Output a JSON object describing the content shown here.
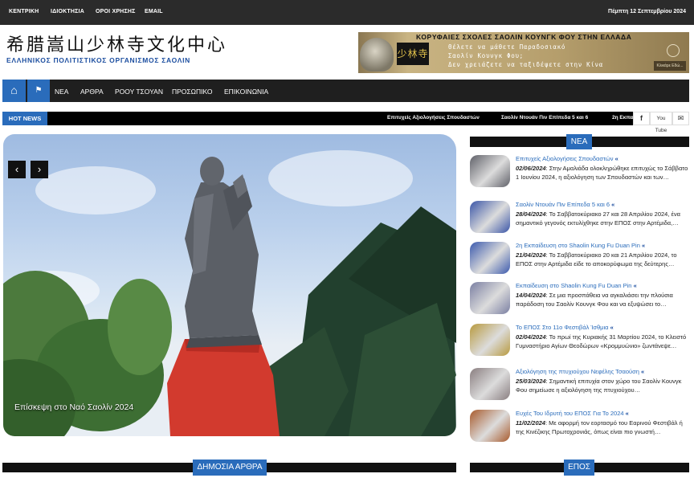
{
  "topbar": {
    "links": [
      "ΚΕΝΤΡΙΚΗ",
      "ΙΔΙΟΚΤΗΣΙΑ",
      "ΟΡΟΙ ΧΡΗΣΗΣ",
      "EMAIL"
    ],
    "date": "Πέμπτη 12 Σεπτεμβρίου 2024"
  },
  "logo": {
    "chinese": "希腊嵩山少林寺文化中心",
    "subtitle": "ΕΛΛΗΝΙΚΟΣ ΠΟΛΙΤΙΣΤΙΚΟΣ ΟΡΓΑΝΙΣΜΟΣ ΣΑΟΛΙΝ"
  },
  "banner": {
    "title": "ΚΟΡΥΦΑΙΕΣ ΣΧΟΛΕΣ ΣΑΟΛΙΝ ΚΟΥΝΓΚ ΦΟΥ ΣΤΗΝ ΕΛΛΑΔΑ",
    "line1": "Θέλετε να μάθετε Παραδοσιακό",
    "line2": "Σαολίν Κουνγκ Φου;",
    "line3": "Δεν χρειάζετε να ταξιδέψετε",
    "line4": "στην Κίνα",
    "seal": "少林寺",
    "button": "Κλικάρε Εδώ..."
  },
  "nav": {
    "items": [
      "ΝΕΑ",
      "ΑΡΘΡΑ",
      "ΡΟΟΥ ΤΣΟΥΑΝ",
      "ΠΡΟΣΩΠΙΚΟ",
      "ΕΠΙΚΟΙΝΩΝΙΑ"
    ]
  },
  "hotnews": {
    "label": "HOT NEWS",
    "ticker": [
      "Επιτυχείς Αξιολογήσεις Σπουδαστών",
      "Σαολίν Ντουάν Πιν Επίπεδα 5 και 6",
      "2η Εκπα"
    ],
    "social": [
      "f",
      "You Tube",
      "✉"
    ]
  },
  "slider": {
    "caption": "Επίσκεψη στο Ναό Σαολίν 2024"
  },
  "news_section": {
    "label": "ΝΕΑ",
    "items": [
      {
        "title": "Επιτυχείς Αξιολογήσεις Σπουδαστών",
        "date": "02/06/2024",
        "excerpt": "Στην Αμαλιάδα ολοκληρώθηκε επιτυχώς το Σάββατο 1 Ιουνίου 2024, η αξιολόγηση των Σπουδαστών και των…",
        "thumb": "#5f6068"
      },
      {
        "title": "Σαολίν Ντουάν Πιν Επίπεδα 5 και 6",
        "date": "28/04/2024",
        "excerpt": "Το Σαββατοκύριακο 27 και 28 Απριλίου 2024, ένα σημαντικό γεγονός εκτυλίχθηκε στην ΕΠΟΣ στην Αρτέμιδα,…",
        "thumb": "#3a55a7"
      },
      {
        "title": "2η Εκπαίδευση στο Shaolin Kung Fu Duan Pin",
        "date": "21/04/2024",
        "excerpt": "Το Σαββατοκύριακο 20 και 21 Απριλίου 2024, το ΕΠΟΣ στην Αρτέμιδα είδε το αποκορύφωμα της δεύτερης…",
        "thumb": "#3b59ad"
      },
      {
        "title": "Εκπαίδευση στο Shaolin Kung Fu Duan Pin",
        "date": "14/04/2024",
        "excerpt": "Σε μια προσπάθεια να αγκαλιάσει την πλούσια παράδοση του Σαολίν Κουνγκ Φου και να εξυψώσει το…",
        "thumb": "#7a7fa2"
      },
      {
        "title": "Το ΕΠΟΣ Στο 11ο Φεστιβάλ Ίσθμια",
        "date": "02/04/2024",
        "excerpt": "Το πρωί της Κυριακής 31 Μαρτίου 2024, το Κλειστό Γυμναστήριο Αγίων Θεοδώρων «Κρομμυώνιο» ζωντάνεψε…",
        "thumb": "#b89a3e"
      },
      {
        "title": "Αξιολόγηση της πτυχιούχου Νεφέλης Τσαούση",
        "date": "25/03/2024",
        "excerpt": "Σημαντική επιτυχία στον χώρο του Σαολίν Κουνγκ Φου σημείωσε η αξιολόγηση της πτυχιούχου…",
        "thumb": "#8a7e80"
      },
      {
        "title": "Ευχές Του Ιδρυτή του ΕΠΟΣ Για Το 2024",
        "date": "11/02/2024",
        "excerpt": "Με αφορμή τον εορτασμό του Εαρινού Φεστιβάλ ή της Κινέζικης Πρωτοχρονιάς, όπως είναι πιο γνωστή…",
        "thumb": "#a85a2c"
      }
    ]
  },
  "bottom": {
    "left_label": "ΔΗΜΟΣΙΑ ΑΡΘΡΑ",
    "right_label": "ΕΠΟΣ"
  }
}
